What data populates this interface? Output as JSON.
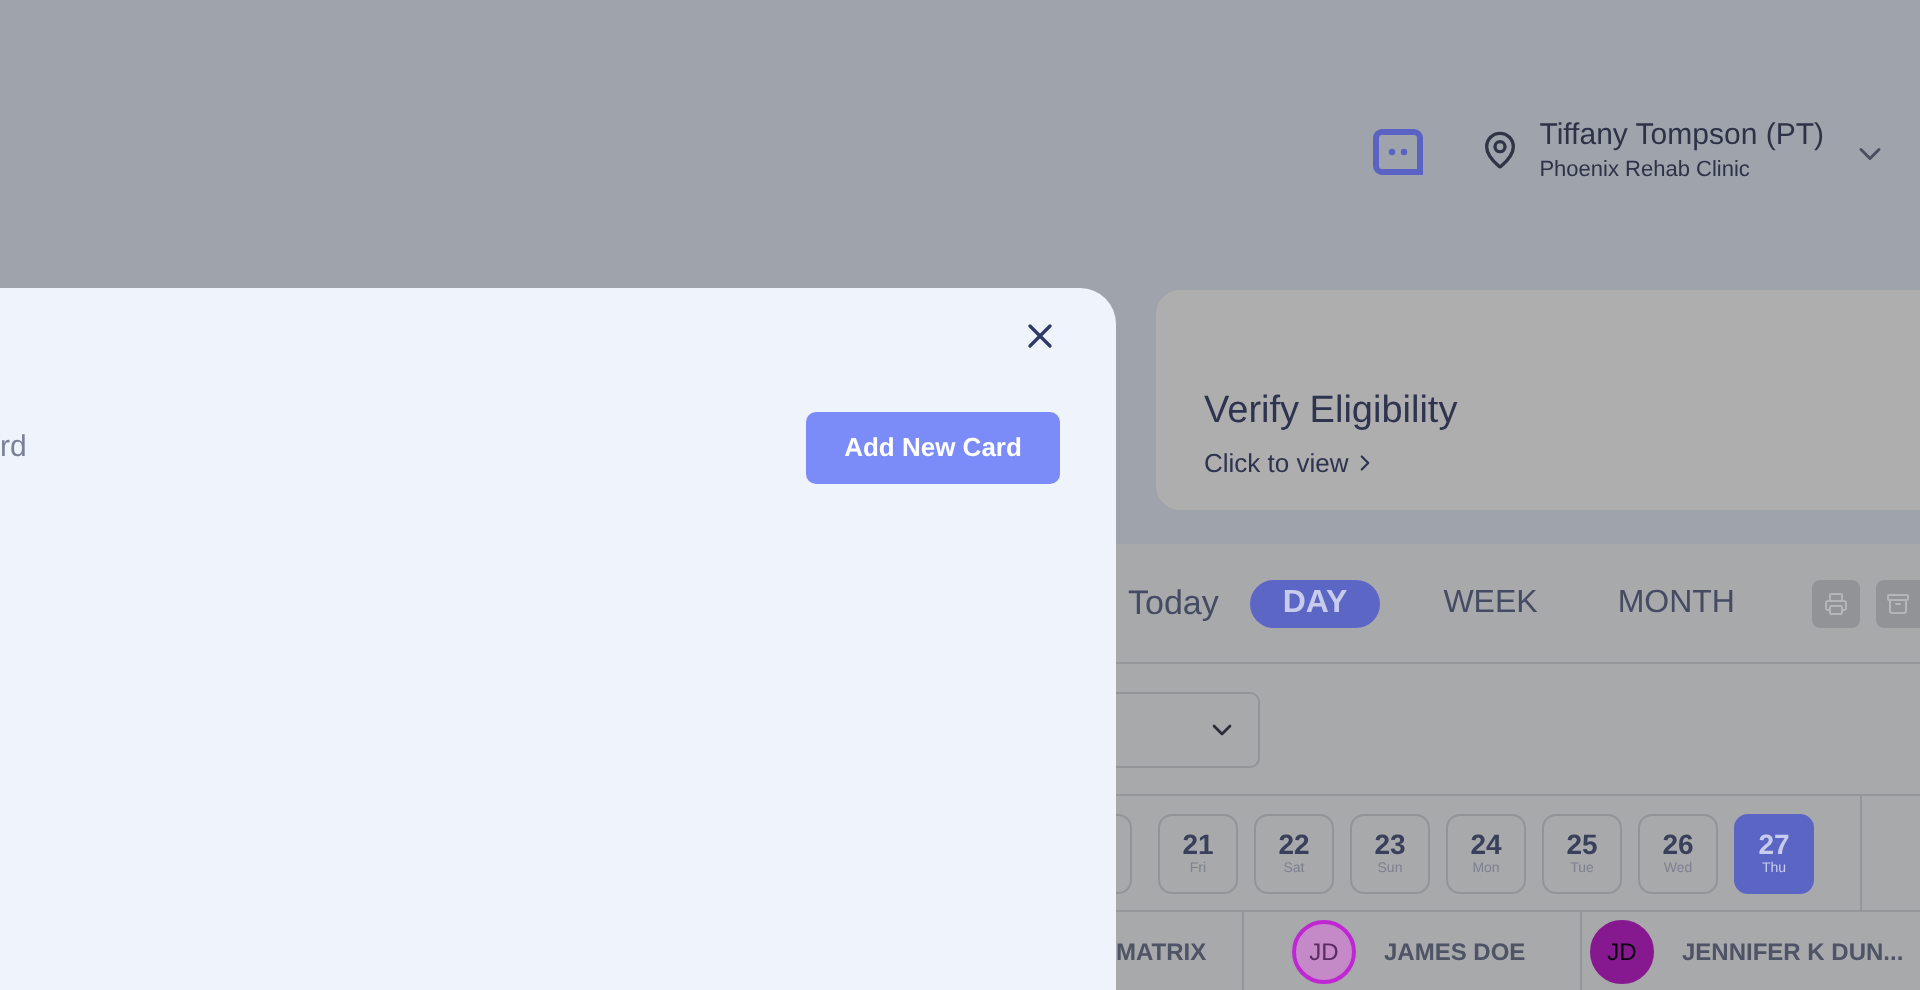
{
  "header": {
    "user_name": "Tiffany Tompson (PT)",
    "clinic": "Phoenix Rehab Clinic"
  },
  "modal": {
    "partial_text": "rd",
    "add_button": "Add New Card"
  },
  "verify_card": {
    "title": "Verify Eligibility",
    "link": "Click to view"
  },
  "calendar": {
    "today": "Today",
    "views": [
      {
        "label": "DAY",
        "selected": true
      },
      {
        "label": "WEEK",
        "selected": false
      },
      {
        "label": "MONTH",
        "selected": false
      }
    ],
    "dates": [
      {
        "day": "21",
        "weekday": "Fri",
        "selected": false
      },
      {
        "day": "22",
        "weekday": "Sat",
        "selected": false
      },
      {
        "day": "23",
        "weekday": "Sun",
        "selected": false
      },
      {
        "day": "24",
        "weekday": "Mon",
        "selected": false
      },
      {
        "day": "25",
        "weekday": "Tue",
        "selected": false
      },
      {
        "day": "26",
        "weekday": "Wed",
        "selected": false
      },
      {
        "day": "27",
        "weekday": "Thu",
        "selected": true
      }
    ],
    "columns": [
      {
        "kind": "text",
        "name": "MATRIX"
      },
      {
        "kind": "provider",
        "initials": "JD",
        "name": "JAMES DOE",
        "color": "#c026d3"
      },
      {
        "kind": "provider",
        "initials": "JD",
        "name": "JENNIFER K DUN...",
        "color": "#86198f"
      }
    ]
  }
}
